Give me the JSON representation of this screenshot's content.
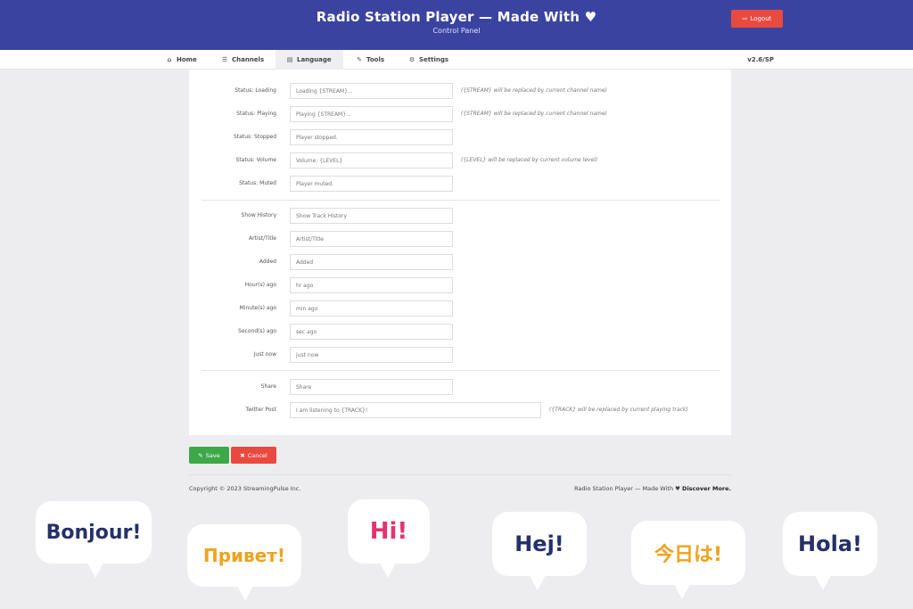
{
  "header": {
    "title": "Radio Station Player — Made With",
    "heart_icon": "heart-icon",
    "subtitle": "Control Panel",
    "logout_label": "Logout",
    "accent": "#3a44a0",
    "danger": "#e94a40"
  },
  "nav": {
    "items": [
      {
        "label": "Home",
        "icon": "home-icon"
      },
      {
        "label": "Channels",
        "icon": "list-icon"
      },
      {
        "label": "Language",
        "icon": "language-icon"
      },
      {
        "label": "Tools",
        "icon": "wrench-icon"
      },
      {
        "label": "Settings",
        "icon": "gears-icon"
      }
    ],
    "active": "Language",
    "version": "v2.6/SP"
  },
  "form": {
    "status_loading": {
      "label": "Status: Loading",
      "value": "Loading {STREAM}...",
      "hint": "({STREAM} will be replaced by current channel name)"
    },
    "status_playing": {
      "label": "Status: Playing",
      "value": "Playing {STREAM}...",
      "hint": "({STREAM} will be replaced by current channel name)"
    },
    "status_stopped": {
      "label": "Status: Stopped",
      "value": "Player stopped."
    },
    "status_volume": {
      "label": "Status: Volume",
      "value": "Volume: {LEVEL}",
      "hint": "({LEVEL} will be replaced by current volume level)"
    },
    "status_muted": {
      "label": "Status: Muted",
      "value": "Player muted."
    },
    "show_history": {
      "label": "Show History",
      "value": "Show Track History"
    },
    "artist_title": {
      "label": "Artist/Title",
      "value": "Artist/Title"
    },
    "added": {
      "label": "Added",
      "value": "Added"
    },
    "hours_ago": {
      "label": "Hour(s) ago",
      "value": "hr ago"
    },
    "minutes_ago": {
      "label": "Minute(s) ago",
      "value": "min ago"
    },
    "seconds_ago": {
      "label": "Second(s) ago",
      "value": "sec ago"
    },
    "just_now": {
      "label": "Just now",
      "value": "just now"
    },
    "share": {
      "label": "Share",
      "value": "Share"
    },
    "twitter_post": {
      "label": "Twitter Post",
      "value": "I am listening to {TRACK}!",
      "hint": "({TRACK} will be replaced by current playing track)"
    }
  },
  "actions": {
    "save_label": "Save",
    "cancel_label": "Cancel",
    "save_color": "#3da848"
  },
  "footer": {
    "copyright": "Copyright © 2023 StreamingPulse Inc.",
    "made_with": "Radio Station Player — Made With",
    "discover": "Discover More."
  },
  "bubbles": [
    "Bonjour!",
    "Привет!",
    "Hi!",
    "Hej!",
    "今日は!",
    "Hola!"
  ]
}
